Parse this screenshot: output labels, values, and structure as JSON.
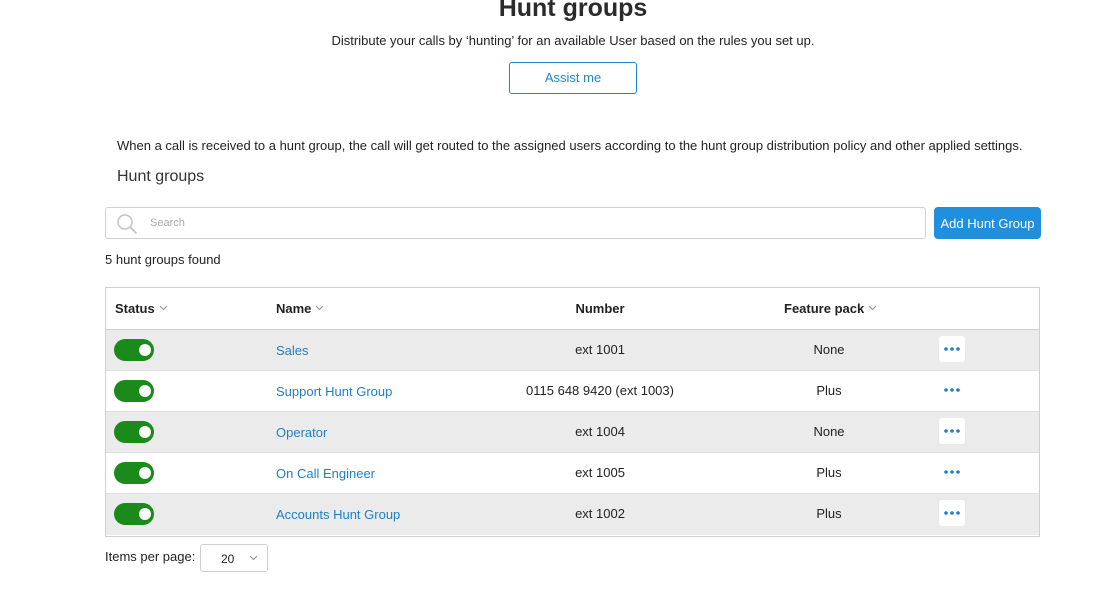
{
  "page": {
    "title": "Hunt groups",
    "subtitle": "Distribute your calls by ‘hunting’ for an available User based on the rules you set up.",
    "assist_label": "Assist me",
    "description": "When a call is received to a hunt group, the call will get routed to the assigned users according to the hunt group distribution policy and other applied settings.",
    "section_title": "Hunt groups"
  },
  "search": {
    "placeholder": "Search",
    "value": ""
  },
  "toolbar": {
    "add_label": "Add Hunt Group"
  },
  "results": {
    "count_text": "5 hunt groups found"
  },
  "table": {
    "columns": {
      "status": "Status",
      "name": "Name",
      "number": "Number",
      "feature_pack": "Feature pack"
    },
    "rows": [
      {
        "enabled": true,
        "name": "Sales",
        "number": "ext 1001",
        "feature_pack": "None"
      },
      {
        "enabled": true,
        "name": "Support Hunt Group",
        "number": "0115 648 9420 (ext 1003)",
        "feature_pack": "Plus"
      },
      {
        "enabled": true,
        "name": "Operator",
        "number": "ext 1004",
        "feature_pack": "None"
      },
      {
        "enabled": true,
        "name": "On Call Engineer",
        "number": "ext 1005",
        "feature_pack": "Plus"
      },
      {
        "enabled": true,
        "name": "Accounts Hunt Group",
        "number": "ext 1002",
        "feature_pack": "Plus"
      }
    ]
  },
  "pagination": {
    "items_per_page_label": "Items per page:",
    "items_per_page_value": "20"
  },
  "colors": {
    "accent": "#1f8fde",
    "link": "#1f7fc4",
    "toggle_on": "#1a8a1a",
    "row_alt": "#ebebeb"
  },
  "icons": {
    "search": "search-icon",
    "sort": "chevron-down-icon",
    "more": "more-horizontal-icon",
    "select": "chevron-down-icon"
  }
}
